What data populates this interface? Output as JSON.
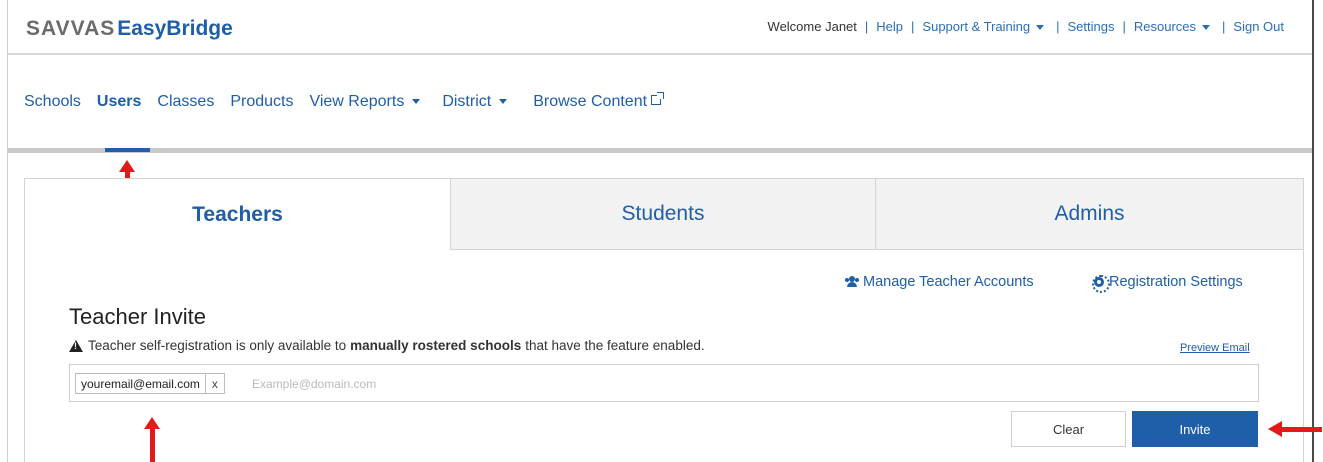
{
  "header": {
    "logo_part1": "SAVVAS",
    "logo_part2": "EasyBridge",
    "welcome": "Welcome Janet",
    "links": {
      "help": "Help",
      "support": "Support & Training",
      "settings": "Settings",
      "resources": "Resources",
      "signout": "Sign Out"
    }
  },
  "nav": {
    "items": [
      {
        "label": "Schools"
      },
      {
        "label": "Users",
        "active": true
      },
      {
        "label": "Classes"
      },
      {
        "label": "Products"
      },
      {
        "label": "View Reports",
        "dropdown": true
      },
      {
        "label": "District",
        "dropdown": true
      },
      {
        "label": "Browse Content",
        "external": true
      }
    ]
  },
  "tabs": [
    {
      "label": "Teachers",
      "active": true
    },
    {
      "label": "Students"
    },
    {
      "label": "Admins"
    }
  ],
  "panel": {
    "manage_link": "Manage Teacher Accounts",
    "registration_link": "Registration Settings",
    "title": "Teacher Invite",
    "notice_pre": "Teacher self-registration is only available to",
    "notice_bold": "manually rostered schools",
    "notice_post": "that have the feature enabled.",
    "preview_email": "Preview Email",
    "email_chip": "youremail@email.com",
    "chip_remove": "x",
    "email_placeholder": "Example@domain.com",
    "clear_label": "Clear",
    "invite_label": "Invite"
  },
  "colors": {
    "brand_blue": "#1f5ea8",
    "annotation_red": "#e21a1a"
  },
  "icons": {
    "manage": "users-icon",
    "registration": "gear-icon",
    "notice": "warning-icon",
    "external": "external-link-icon"
  }
}
